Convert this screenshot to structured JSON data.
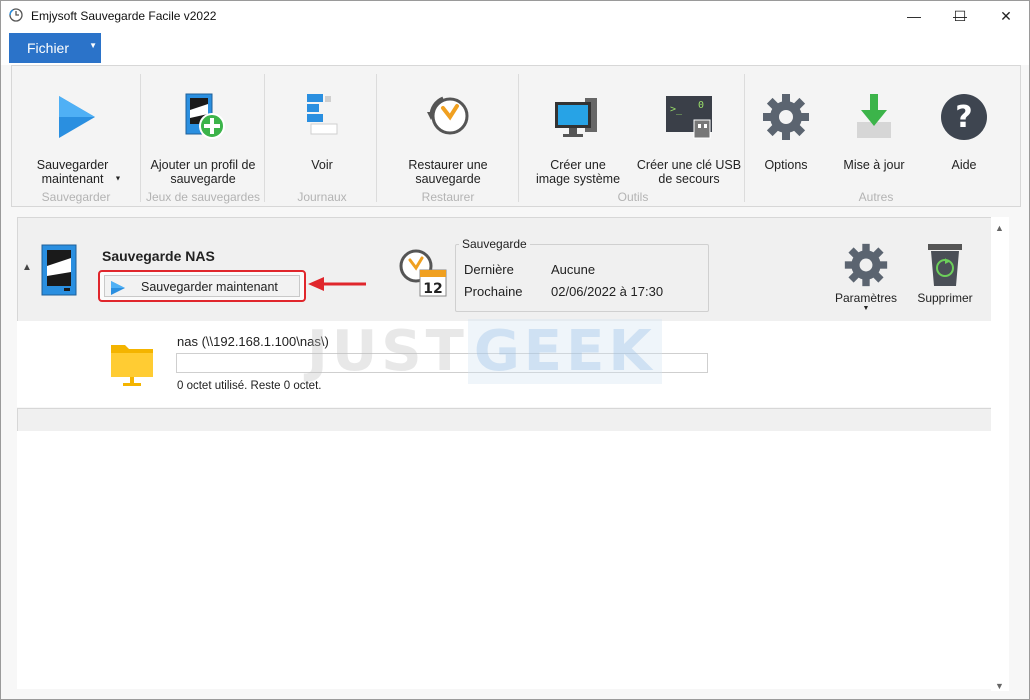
{
  "window": {
    "title": "Emjysoft Sauvegarde Facile v2022",
    "controls": {
      "minimize": "—",
      "maximize": "☐",
      "close": "✕"
    }
  },
  "menu": {
    "file_label": "Fichier",
    "file_arrow": "▼"
  },
  "ribbon": {
    "buttons": [
      {
        "label": "Sauvegarder maintenant",
        "icon": "play-icon"
      },
      {
        "label": "Ajouter un profil de sauvegarde",
        "icon": "add-profile-icon"
      },
      {
        "label": "Voir",
        "icon": "log-view-icon"
      },
      {
        "label": "Restaurer une sauvegarde",
        "icon": "restore-clock-icon"
      },
      {
        "label": "Créer une image système",
        "icon": "monitor-icon"
      },
      {
        "label": "Créer une clé USB de secours",
        "icon": "usb-terminal-icon"
      },
      {
        "label": "Options",
        "icon": "gear-icon"
      },
      {
        "label": "Mise à jour",
        "icon": "download-arrow-icon"
      },
      {
        "label": "Aide",
        "icon": "help-icon"
      }
    ],
    "groups": [
      "Sauvegarder",
      "Jeux de sauvegardes",
      "Journaux",
      "Restaurer",
      "Outils",
      "Autres"
    ]
  },
  "profile": {
    "name": "Sauvegarde NAS",
    "run_button": "Sauvegarder maintenant",
    "schedule": {
      "legend": "Sauvegarde",
      "last_label": "Dernière",
      "last_value": "Aucune",
      "next_label": "Prochaine",
      "next_value": "02/06/2022 à 17:30",
      "calendar_day": "12"
    },
    "settings_label": "Paramètres",
    "delete_label": "Supprimer"
  },
  "destination": {
    "path": "nas (\\\\192.168.1.100\\nas\\)",
    "usage_fraction": 0,
    "usage_text": "0 octet utilisé. Reste 0 octet."
  },
  "watermark": {
    "part1": "JUST",
    "part2": "GEEK"
  },
  "colors": {
    "accent": "#2b73c9",
    "highlight": "#e0262c",
    "play": "#2a8fe0"
  }
}
